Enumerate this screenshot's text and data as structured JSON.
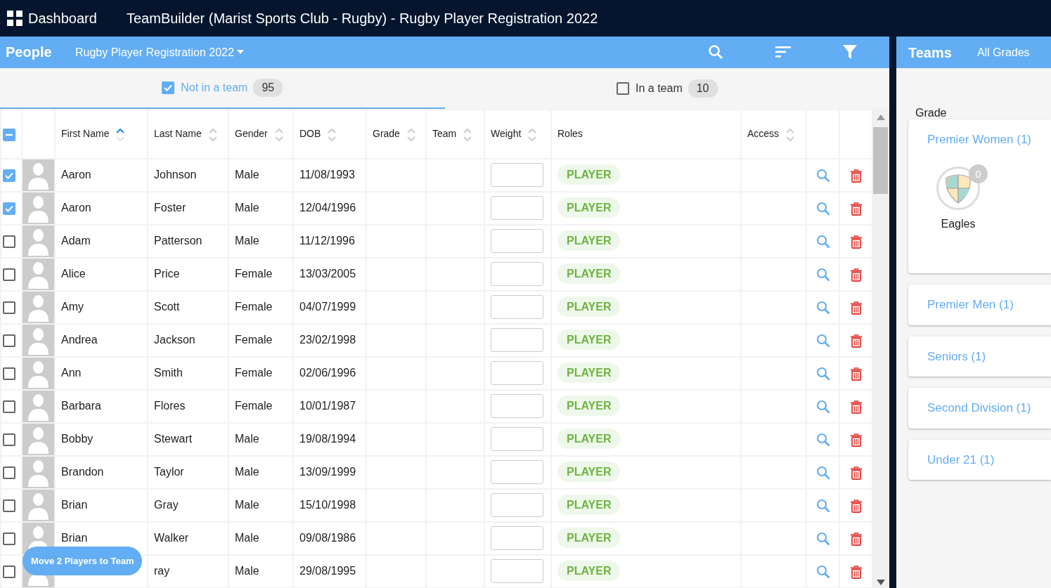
{
  "topbar": {
    "menu_label": "Dashboard",
    "title": "TeamBuilder (Marist Sports Club - Rugby) - Rugby Player Registration 2022"
  },
  "people": {
    "title": "People",
    "selector": "Rugby Player Registration 2022"
  },
  "filter_tabs": [
    {
      "label": "Not in a team",
      "count": "95",
      "selected": true
    },
    {
      "label": "In a team",
      "count": "10",
      "selected": false
    }
  ],
  "table": {
    "header_checkbox_partial": true,
    "columns": [
      {
        "label": "First Name",
        "sortable": true,
        "sorted": true
      },
      {
        "label": "Last Name",
        "sortable": true,
        "sorted": false
      },
      {
        "label": "Gender",
        "sortable": true,
        "sorted": false
      },
      {
        "label": "DOB",
        "sortable": true,
        "sorted": false
      },
      {
        "label": "Grade",
        "sortable": true,
        "sorted": false
      },
      {
        "label": "Team",
        "sortable": true,
        "sorted": false
      },
      {
        "label": "Weight",
        "sortable": true,
        "sorted": false
      },
      {
        "label": "Roles",
        "sortable": false
      },
      {
        "label": "Access",
        "sortable": true,
        "sorted": false
      }
    ],
    "rows": [
      {
        "checked": true,
        "first_name": "Aaron",
        "last_name": "Johnson",
        "gender": "Male",
        "dob": "11/08/1993",
        "role": "PLAYER"
      },
      {
        "checked": true,
        "first_name": "Aaron",
        "last_name": "Foster",
        "gender": "Male",
        "dob": "12/04/1996",
        "role": "PLAYER"
      },
      {
        "checked": false,
        "first_name": "Adam",
        "last_name": "Patterson",
        "gender": "Male",
        "dob": "11/12/1996",
        "role": "PLAYER"
      },
      {
        "checked": false,
        "first_name": "Alice",
        "last_name": "Price",
        "gender": "Female",
        "dob": "13/03/2005",
        "role": "PLAYER"
      },
      {
        "checked": false,
        "first_name": "Amy",
        "last_name": "Scott",
        "gender": "Female",
        "dob": "04/07/1999",
        "role": "PLAYER"
      },
      {
        "checked": false,
        "first_name": "Andrea",
        "last_name": "Jackson",
        "gender": "Female",
        "dob": "23/02/1998",
        "role": "PLAYER"
      },
      {
        "checked": false,
        "first_name": "Ann",
        "last_name": "Smith",
        "gender": "Female",
        "dob": "02/06/1996",
        "role": "PLAYER"
      },
      {
        "checked": false,
        "first_name": "Barbara",
        "last_name": "Flores",
        "gender": "Female",
        "dob": "10/01/1987",
        "role": "PLAYER"
      },
      {
        "checked": false,
        "first_name": "Bobby",
        "last_name": "Stewart",
        "gender": "Male",
        "dob": "19/08/1994",
        "role": "PLAYER"
      },
      {
        "checked": false,
        "first_name": "Brandon",
        "last_name": "Taylor",
        "gender": "Male",
        "dob": "13/09/1999",
        "role": "PLAYER"
      },
      {
        "checked": false,
        "first_name": "Brian",
        "last_name": "Gray",
        "gender": "Male",
        "dob": "15/10/1998",
        "role": "PLAYER"
      },
      {
        "checked": false,
        "first_name": "Brian",
        "last_name": "Walker",
        "gender": "Male",
        "dob": "09/08/1986",
        "role": "PLAYER"
      },
      {
        "checked": false,
        "last_name": "ray",
        "gender": "Male",
        "dob": "29/08/1995",
        "role": "PLAYER"
      }
    ]
  },
  "move_button": "Move 2 Players to Team",
  "teams": {
    "title": "Teams",
    "filter": "All Grades",
    "group_label": "Grade",
    "grades": [
      {
        "label": "Premier Women (1)",
        "expanded": true,
        "teams": [
          {
            "name": "Eagles",
            "count": "0"
          }
        ]
      },
      {
        "label": "Premier Men (1)",
        "expanded": false
      },
      {
        "label": "Seniors (1)",
        "expanded": false
      },
      {
        "label": "Second Division (1)",
        "expanded": false
      },
      {
        "label": "Under 21 (1)",
        "expanded": false
      }
    ]
  }
}
